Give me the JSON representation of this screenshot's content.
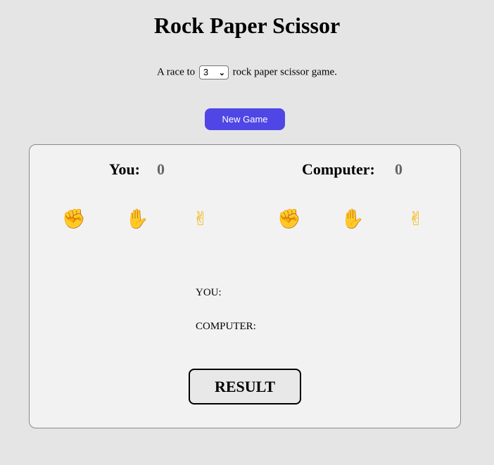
{
  "title": "Rock Paper Scissor",
  "race": {
    "prefix": "A race to",
    "selected": "3",
    "suffix": "rock paper scissor game."
  },
  "new_game_label": "New Game",
  "scores": {
    "player_label": "You:",
    "player_value": "0",
    "computer_label": "Computer:",
    "computer_value": "0"
  },
  "hands": {
    "player": [
      {
        "icon": "rock-icon",
        "glyph": "✊"
      },
      {
        "icon": "paper-icon",
        "glyph": "✋"
      },
      {
        "icon": "scissor-icon",
        "glyph": "✌"
      }
    ],
    "computer": [
      {
        "icon": "rock-icon",
        "glyph": "✊"
      },
      {
        "icon": "paper-icon",
        "glyph": "✋"
      },
      {
        "icon": "scissor-icon",
        "glyph": "✌"
      }
    ]
  },
  "picks": {
    "you_label": "YOU:",
    "computer_label": "COMPUTER:"
  },
  "result_label": "RESULT",
  "colors": {
    "background": "#e5e5e5",
    "board": "#f2f2f2",
    "accent": "#4f46e5",
    "emoji": "#f4b400"
  }
}
